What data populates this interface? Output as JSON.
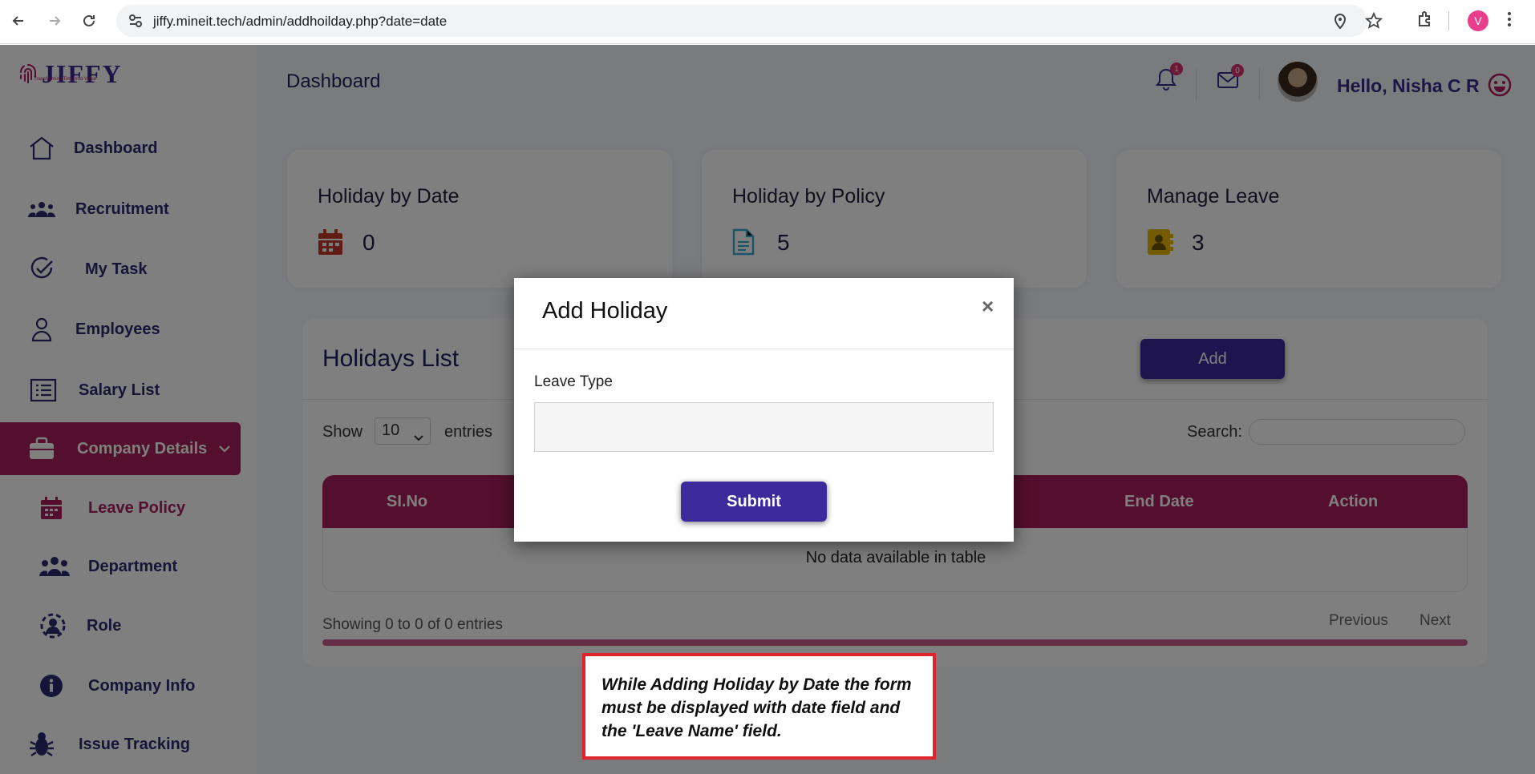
{
  "browser": {
    "url": "jiffy.mineit.tech/admin/addhoilday.php?date=date",
    "profile_initial": "V"
  },
  "app": {
    "logo_text": "JIFFY",
    "logo_tagline": "Transforming Time Into Value",
    "page_title": "Dashboard",
    "notifications_count": "1",
    "messages_count": "0",
    "greeting": "Hello, Nisha C R"
  },
  "sidebar": {
    "items": [
      {
        "label": "Dashboard",
        "icon": "home-icon"
      },
      {
        "label": "Recruitment",
        "icon": "users-icon"
      },
      {
        "label": "My Task",
        "icon": "check-circle-icon"
      },
      {
        "label": "Employees",
        "icon": "user-icon"
      },
      {
        "label": "Salary List",
        "icon": "list-icon"
      },
      {
        "label": "Company Details",
        "icon": "briefcase-icon"
      },
      {
        "label": "Leave Policy",
        "icon": "calendar-icon"
      },
      {
        "label": "Department",
        "icon": "group-icon"
      },
      {
        "label": "Role",
        "icon": "user-gear-icon"
      },
      {
        "label": "Company Info",
        "icon": "info-icon"
      },
      {
        "label": "Issue Tracking",
        "icon": "bug-icon"
      }
    ]
  },
  "cards": [
    {
      "title": "Holiday by Date",
      "value": "0",
      "icon": "calendar-icon",
      "color": "#c0392b"
    },
    {
      "title": "Holiday by Policy",
      "value": "5",
      "icon": "document-icon",
      "color": "#3aa6c8"
    },
    {
      "title": "Manage Leave",
      "value": "3",
      "icon": "contact-book-icon",
      "color": "#e6b800"
    }
  ],
  "holidays_list": {
    "title": "Holidays List",
    "add_label": "Add",
    "show_label": "Show",
    "show_value": "10",
    "entries_label": "entries",
    "search_label": "Search:",
    "columns": [
      "SI.No",
      "End Date",
      "Action"
    ],
    "empty_text": "No data available in table",
    "info_text": "Showing 0 to 0 of 0 entries",
    "previous_label": "Previous",
    "next_label": "Next"
  },
  "modal": {
    "title": "Add Holiday",
    "close_label": "×",
    "field_label": "Leave Type",
    "field_value": "",
    "submit_label": "Submit"
  },
  "annotation": {
    "text": "While Adding Holiday by Date the form must be displayed with date field and the 'Leave Name' field."
  },
  "colors": {
    "brand_primary": "#3d2b9d",
    "brand_accent": "#a71e5a",
    "annotation_border": "#e1242b"
  }
}
